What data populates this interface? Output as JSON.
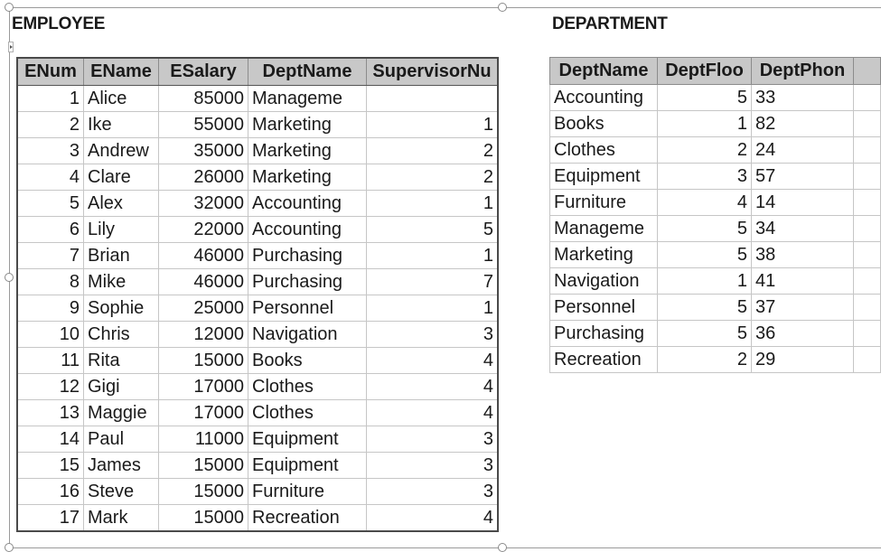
{
  "employee": {
    "title": "EMPLOYEE",
    "columns": [
      "ENum",
      "EName",
      "ESalary",
      "DeptName",
      "SupervisorNu"
    ],
    "rows": [
      [
        "1",
        "Alice",
        "85000",
        "Manageme",
        ""
      ],
      [
        "2",
        "Ike",
        "55000",
        "Marketing",
        "1"
      ],
      [
        "3",
        "Andrew",
        "35000",
        "Marketing",
        "2"
      ],
      [
        "4",
        "Clare",
        "26000",
        "Marketing",
        "2"
      ],
      [
        "5",
        "Alex",
        "32000",
        "Accounting",
        "1"
      ],
      [
        "6",
        "Lily",
        "22000",
        "Accounting",
        "5"
      ],
      [
        "7",
        "Brian",
        "46000",
        "Purchasing",
        "1"
      ],
      [
        "8",
        "Mike",
        "46000",
        "Purchasing",
        "7"
      ],
      [
        "9",
        "Sophie",
        "25000",
        "Personnel",
        "1"
      ],
      [
        "10",
        "Chris",
        "12000",
        "Navigation",
        "3"
      ],
      [
        "11",
        "Rita",
        "15000",
        "Books",
        "4"
      ],
      [
        "12",
        "Gigi",
        "17000",
        "Clothes",
        "4"
      ],
      [
        "13",
        "Maggie",
        "17000",
        "Clothes",
        "4"
      ],
      [
        "14",
        "Paul",
        "11000",
        "Equipment",
        "3"
      ],
      [
        "15",
        "James",
        "15000",
        "Equipment",
        "3"
      ],
      [
        "16",
        "Steve",
        "15000",
        "Furniture",
        "3"
      ],
      [
        "17",
        "Mark",
        "15000",
        "Recreation",
        "4"
      ]
    ]
  },
  "department": {
    "title": "DEPARTMENT",
    "columns": [
      "DeptName",
      "DeptFloo",
      "DeptPhon",
      ""
    ],
    "rows": [
      [
        "Accounting",
        "5",
        "33",
        ""
      ],
      [
        "Books",
        "1",
        "82",
        ""
      ],
      [
        "Clothes",
        "2",
        "24",
        ""
      ],
      [
        "Equipment",
        "3",
        "57",
        ""
      ],
      [
        "Furniture",
        "4",
        "14",
        ""
      ],
      [
        "Manageme",
        "5",
        "34",
        ""
      ],
      [
        "Marketing",
        "5",
        "38",
        ""
      ],
      [
        "Navigation",
        "1",
        "41",
        ""
      ],
      [
        "Personnel",
        "5",
        "37",
        ""
      ],
      [
        "Purchasing",
        "5",
        "36",
        ""
      ],
      [
        "Recreation",
        "2",
        "29",
        ""
      ]
    ]
  },
  "colors": {
    "header_bg": "#c8c8c8",
    "grid_line": "#c6c6c6",
    "outer_border": "#4a4a4a"
  }
}
